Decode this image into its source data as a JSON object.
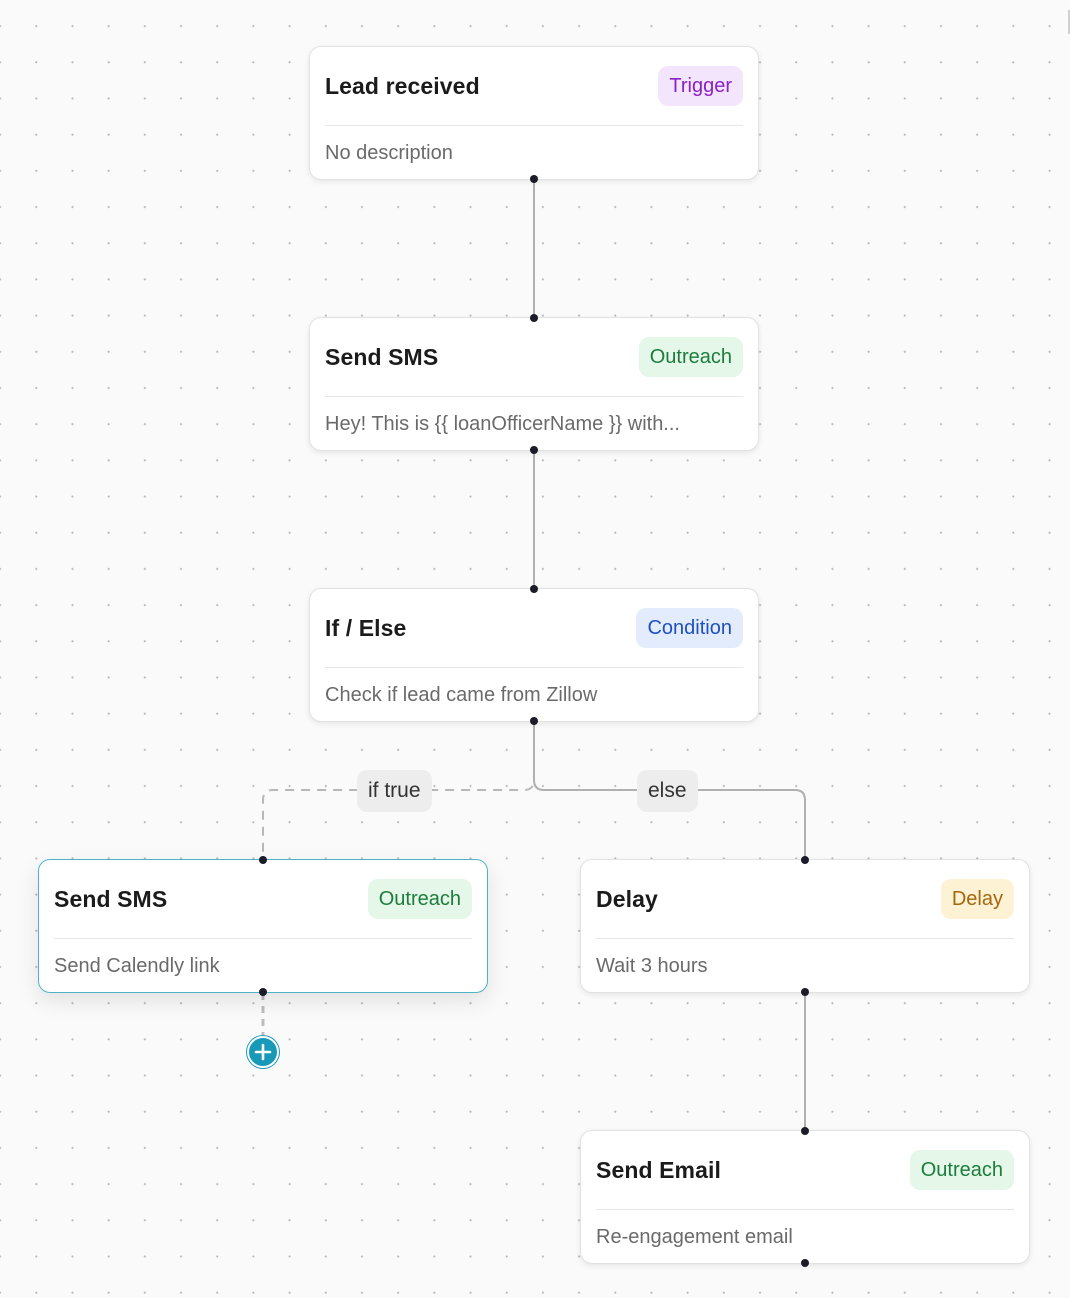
{
  "nodes": [
    {
      "id": "lead-received",
      "title": "Lead received",
      "badge": "Trigger",
      "badge_type": "trigger",
      "description": "No description",
      "selected": false
    },
    {
      "id": "send-sms-1",
      "title": "Send SMS",
      "badge": "Outreach",
      "badge_type": "outreach",
      "description": "Hey! This is {{ loanOfficerName }} with...",
      "selected": false
    },
    {
      "id": "if-else",
      "title": "If / Else",
      "badge": "Condition",
      "badge_type": "condition",
      "description": "Check if lead came from Zillow",
      "selected": false
    },
    {
      "id": "send-sms-2",
      "title": "Send SMS",
      "badge": "Outreach",
      "badge_type": "outreach",
      "description": "Send Calendly link",
      "selected": true
    },
    {
      "id": "delay",
      "title": "Delay",
      "badge": "Delay",
      "badge_type": "delay",
      "description": "Wait 3 hours",
      "selected": false
    },
    {
      "id": "send-email",
      "title": "Send Email",
      "badge": "Outreach",
      "badge_type": "outreach",
      "description": "Re-engagement email",
      "selected": false
    }
  ],
  "edges": [
    {
      "from": "lead-received",
      "to": "send-sms-1",
      "style": "solid",
      "label": ""
    },
    {
      "from": "send-sms-1",
      "to": "if-else",
      "style": "solid",
      "label": ""
    },
    {
      "from": "if-else",
      "to": "send-sms-2",
      "style": "dashed",
      "label": "if true"
    },
    {
      "from": "if-else",
      "to": "delay",
      "style": "solid",
      "label": "else"
    },
    {
      "from": "delay",
      "to": "send-email",
      "style": "solid",
      "label": ""
    }
  ],
  "edge_labels": {
    "if_true": "if true",
    "else": "else"
  },
  "add_step": {
    "icon": "plus-icon",
    "label": "+"
  },
  "colors": {
    "accent": "#1899b7",
    "selected_border": "#4fb3c8",
    "edge": "#b0b0b0",
    "handle": "#1c1c28"
  }
}
